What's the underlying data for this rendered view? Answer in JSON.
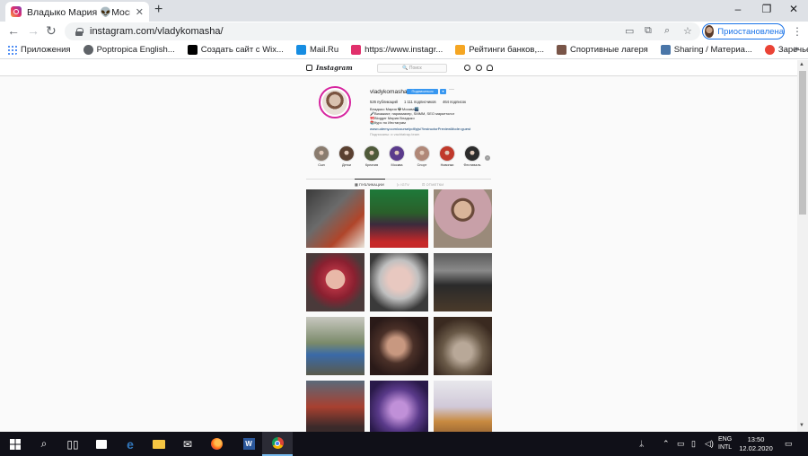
{
  "browser": {
    "tab_title": "Владыко Мария 👽Москва🌃 ...",
    "url": "instagram.com/vladykomasha/",
    "profile_label": "Приостановлена",
    "bookmarks": [
      {
        "label": "Приложения",
        "icon": "apps-grid-icon",
        "color": "#4285f4"
      },
      {
        "label": "Poptropica English...",
        "icon": "poptropica-icon",
        "color": "#5f6368"
      },
      {
        "label": "Создать сайт с Wix...",
        "icon": "wix-icon",
        "color": "#000000"
      },
      {
        "label": "Mail.Ru",
        "icon": "mailru-icon",
        "color": "#168de2"
      },
      {
        "label": "https://www.instagr...",
        "icon": "instagram-icon",
        "color": "#e1306c"
      },
      {
        "label": "Рейтинги банков,...",
        "icon": "banki-icon",
        "color": "#f5a623"
      },
      {
        "label": "Спортивные лагеря",
        "icon": "camp-icon",
        "color": "#795548"
      },
      {
        "label": "Sharing / Материа...",
        "icon": "vk-icon",
        "color": "#4a76a8"
      },
      {
        "label": "Заречье",
        "icon": "map-pin-icon",
        "color": "#ea4335"
      }
    ]
  },
  "instagram": {
    "search_placeholder": "🔍 Поиск",
    "username": "vladykomasha",
    "follow_label": "Подписаться",
    "follow_arrow": "▾",
    "more": "···",
    "stats": {
      "posts": "526 публикаций",
      "followers": "1 111 подписчиков",
      "following": "464 подписок"
    },
    "bio": [
      "Владыко Мария 👽Москва🌃",
      "🎤Визажист, парикмахер, SMMM, SEO маркетолог",
      "🎀Blogger Мария Владыко",
      "📚Курс по Инстаграм",
      "www.udemy.com/course/pdf/pjs/?instructorPreviewMode=guest"
    ],
    "followed_by": "Подписаны: и vachtatrap.team",
    "highlights": [
      "Сын",
      "Детки",
      "Креатив",
      "Москва",
      "Спорт",
      "Новинки",
      "Фестиваль"
    ],
    "highlight_colors": [
      "#8a7c6f",
      "#5a4030",
      "#4f5a3a",
      "#5b3b8c",
      "#b08878",
      "#c0392b",
      "#2c2c2c"
    ],
    "tabs": [
      "▦ ПУБЛИКАЦИИ",
      "▷ IGTV",
      "⊡ ОТМЕТКИ"
    ],
    "posts": [
      {
        "bg": "linear-gradient(135deg,#3a3a3a 0%,#6b6b6b 40%,#b0452a 70%,#e9e3d9 100%)"
      },
      {
        "bg": "linear-gradient(180deg,#1e7a3a 0%,#2a5f2a 40%,#3d2a3d 60%,#c62828 90%)"
      },
      {
        "bg": "radial-gradient(circle at 50% 35%,#d9b59a 18%,#6a4a3a 19%,#6a4a3a 24%,#c8a0a8 25%,#c8a0a8 60%,#9a8a7a 61%)"
      },
      {
        "bg": "radial-gradient(circle at 50% 45%,#e8b8a8 22%,#b03040 23%,#8a2030 45%,#4a3a3a 70%)"
      },
      {
        "bg": "radial-gradient(circle at 50% 45%,#e8c8c0 25%,#c0c0c0 45%,#3a3a3a 75%)"
      },
      {
        "bg": "linear-gradient(180deg,#5a5a5a 0%,#8a8a8a 30%,#2a2a2a 55%,#4a3a2a 100%)"
      },
      {
        "bg": "linear-gradient(180deg,#c8c8c0 0%,#7a8a6a 45%,#3a6aa8 65%,#5a5a4a 100%)"
      },
      {
        "bg": "radial-gradient(circle at 45% 50%,#c89880 20%,#4a3028 40%,#2a1a18 70%)"
      },
      {
        "bg": "radial-gradient(circle at 50% 60%,#b8a898 20%,#6a5a48 45%,#3a2a20 75%)"
      },
      {
        "bg": "linear-gradient(180deg,#5a6a7a 0%,#a84030 45%,#3a2a2a 80%)"
      },
      {
        "bg": "radial-gradient(circle at 50% 50%,#c090d8 20%,#5a3a8a 50%,#2a1a4a 80%)"
      },
      {
        "bg": "linear-gradient(180deg,#e8e8ec 0%,#d0c8d8 45%,#c88a40 70%,#8a5a30 100%)"
      }
    ]
  },
  "taskbar": {
    "apps": [
      "start-icon",
      "search-icon",
      "task-view-icon",
      "store-icon",
      "edge-icon",
      "explorer-icon",
      "mail-icon",
      "firefox-icon",
      "word-icon",
      "chrome-icon"
    ],
    "lang_1": "ENG",
    "lang_2": "INTL",
    "time": "13:50",
    "date": "12.02.2020"
  }
}
